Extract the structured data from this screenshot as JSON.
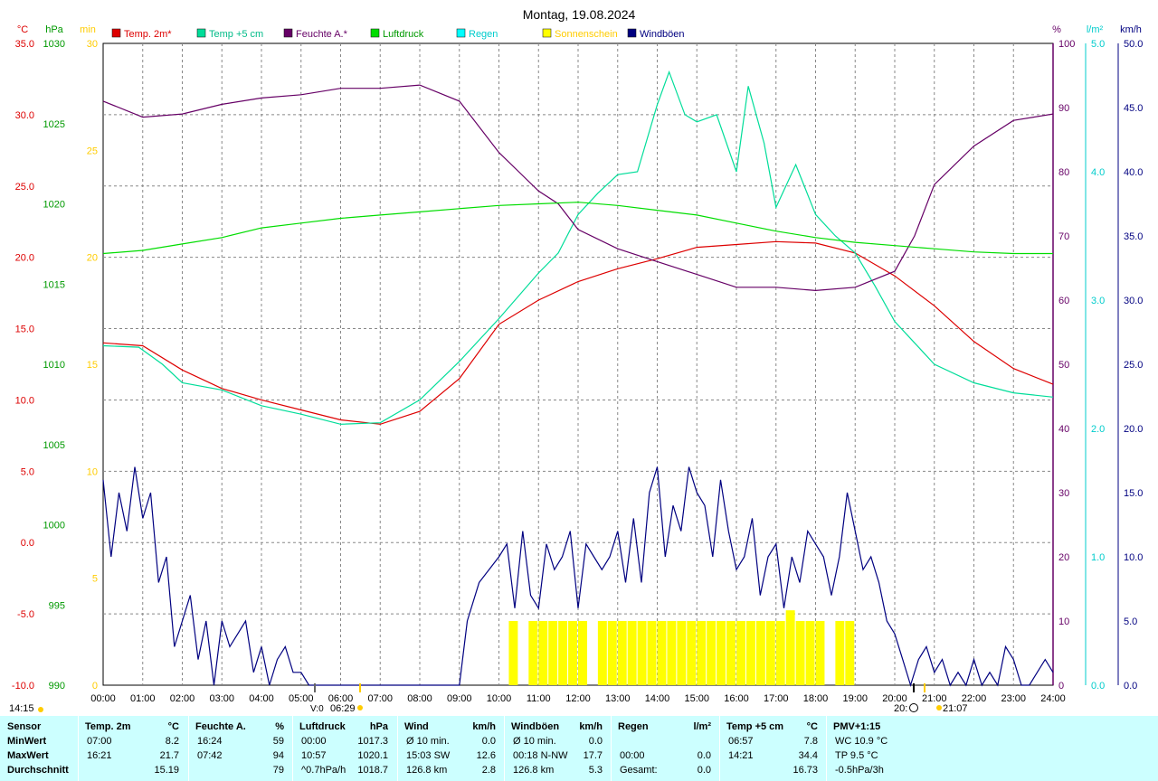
{
  "title": "Montag, 19.08.2024",
  "legend": [
    {
      "label": "Temp. 2m*",
      "color": "#dd0000",
      "text_color": "#dd0000"
    },
    {
      "label": "Temp +5 cm",
      "color": "#00dd99",
      "text_color": "#00bb88"
    },
    {
      "label": "Feuchte A.*",
      "color": "#660066",
      "text_color": "#660066"
    },
    {
      "label": "Luftdruck",
      "color": "#00dd00",
      "text_color": "#009900"
    },
    {
      "label": "Regen",
      "color": "#00ffff",
      "text_color": "#00cccc"
    },
    {
      "label": "Sonnenschein",
      "color": "#ffff00",
      "text_color": "#ffcc00"
    },
    {
      "label": "Windböen",
      "color": "#000080",
      "text_color": "#000080"
    }
  ],
  "axes": {
    "temp": {
      "unit": "°C",
      "ticks": [
        "35.0",
        "30.0",
        "25.0",
        "20.0",
        "15.0",
        "10.0",
        "5.0",
        "0.0",
        "-5.0",
        "-10.0"
      ],
      "color": "#dd0000"
    },
    "pressure": {
      "unit": "hPa",
      "ticks": [
        "1030",
        "1025",
        "1020",
        "1015",
        "1010",
        "1005",
        "1000",
        "995",
        "990"
      ],
      "color": "#009900"
    },
    "sun": {
      "unit": "min",
      "ticks": [
        "30",
        "25",
        "20",
        "15",
        "10",
        "5",
        "0"
      ],
      "color": "#ffcc00"
    },
    "humidity": {
      "unit": "%",
      "ticks": [
        "100",
        "90",
        "80",
        "70",
        "60",
        "50",
        "40",
        "30",
        "20",
        "10",
        "0"
      ],
      "color": "#660066"
    },
    "rain": {
      "unit": "l/m²",
      "ticks": [
        "5.0",
        "4.0",
        "3.0",
        "2.0",
        "1.0",
        "0.0"
      ],
      "color": "#00cccc"
    },
    "wind": {
      "unit": "km/h",
      "ticks": [
        "50.0",
        "45.0",
        "40.0",
        "35.0",
        "30.0",
        "25.0",
        "20.0",
        "15.0",
        "10.0",
        "5.0",
        "0.0"
      ],
      "color": "#000080"
    },
    "time_ticks": [
      "00:00",
      "01:00",
      "02:00",
      "03:00",
      "04:00",
      "05:00",
      "06:00",
      "07:00",
      "08:00",
      "09:00",
      "10:00",
      "11:00",
      "12:00",
      "13:00",
      "14:00",
      "15:00",
      "16:00",
      "17:00",
      "18:00",
      "19:00",
      "20:00",
      "21:00",
      "22:00",
      "23:00",
      "24:00"
    ]
  },
  "markers": {
    "left_time": "14:15",
    "sunrise": "06:29",
    "sunset_moon": "20:",
    "sunset": "21:07",
    "small_marker": "V:0"
  },
  "chart_data": {
    "type": "line",
    "x_unit": "hours",
    "xlim": [
      0,
      24
    ],
    "series": [
      {
        "name": "Temp. 2m*",
        "axis": "temp",
        "color": "#dd0000",
        "x": [
          0,
          1,
          2,
          3,
          4,
          5,
          6,
          7,
          8,
          9,
          10,
          11,
          12,
          13,
          14,
          15,
          16,
          17,
          18,
          19,
          20,
          21,
          22,
          23,
          24
        ],
        "y": [
          14.0,
          13.8,
          12.1,
          10.8,
          10.0,
          9.3,
          8.6,
          8.3,
          9.2,
          11.5,
          15.3,
          17.0,
          18.3,
          19.2,
          19.9,
          20.7,
          20.9,
          21.1,
          21.0,
          20.3,
          18.7,
          16.6,
          14.1,
          12.2,
          11.1
        ]
      },
      {
        "name": "Temp +5 cm",
        "axis": "temp",
        "color": "#00dd99",
        "x": [
          0,
          0.9,
          1.5,
          2.0,
          3.0,
          4.0,
          5.0,
          6.0,
          7.0,
          8.0,
          9.0,
          10.0,
          11.0,
          11.5,
          12.0,
          12.5,
          13.0,
          13.5,
          14.0,
          14.3,
          14.7,
          15.0,
          15.5,
          16.0,
          16.3,
          16.7,
          17.0,
          17.5,
          18.0,
          18.5,
          19.0,
          19.5,
          20.0,
          20.5,
          21.0,
          22.0,
          23.0,
          24.0
        ],
        "y": [
          13.8,
          13.7,
          12.5,
          11.2,
          10.7,
          9.6,
          9.0,
          8.3,
          8.4,
          10.0,
          12.7,
          15.7,
          18.9,
          20.3,
          23.0,
          24.5,
          25.8,
          26.0,
          30.7,
          33.0,
          30.0,
          29.5,
          30.0,
          26.0,
          32.0,
          28.0,
          23.5,
          26.5,
          23.0,
          21.5,
          20.3,
          18.0,
          15.5,
          14.0,
          12.5,
          11.2,
          10.5,
          10.2
        ]
      },
      {
        "name": "Feuchte A.*",
        "axis": "humidity",
        "color": "#660066",
        "x": [
          0,
          1,
          2,
          3,
          4,
          5,
          6,
          7,
          8,
          9,
          10,
          10.5,
          11,
          11.5,
          12,
          13,
          14,
          15,
          16,
          17,
          18,
          19,
          20,
          20.5,
          21,
          22,
          23,
          24
        ],
        "y": [
          91,
          88.5,
          89,
          90.5,
          91.5,
          92,
          93,
          93,
          93.5,
          91,
          83,
          80,
          77,
          75,
          71,
          68,
          66,
          64,
          62,
          62,
          61.5,
          62,
          64.5,
          70,
          78,
          84,
          88,
          89
        ]
      },
      {
        "name": "Luftdruck",
        "axis": "pressure",
        "color": "#00dd00",
        "x": [
          0,
          1,
          2,
          3,
          4,
          5,
          6,
          7,
          8,
          9,
          10,
          11,
          12,
          13,
          14,
          15,
          16,
          17,
          18,
          19,
          20,
          21,
          22,
          23,
          24
        ],
        "y": [
          1016.9,
          1017.1,
          1017.5,
          1017.9,
          1018.5,
          1018.8,
          1019.1,
          1019.3,
          1019.5,
          1019.7,
          1019.9,
          1020.0,
          1020.1,
          1019.9,
          1019.6,
          1019.3,
          1018.8,
          1018.3,
          1017.9,
          1017.6,
          1017.4,
          1017.2,
          1017.0,
          1016.9,
          1016.9
        ]
      },
      {
        "name": "Windböen",
        "axis": "wind",
        "color": "#000080",
        "x": [
          0,
          0.2,
          0.4,
          0.6,
          0.8,
          1.0,
          1.2,
          1.4,
          1.6,
          1.8,
          2.0,
          2.2,
          2.4,
          2.6,
          2.8,
          3.0,
          3.2,
          3.4,
          3.6,
          3.8,
          4.0,
          4.2,
          4.4,
          4.6,
          4.8,
          5.0,
          5.2,
          5.4,
          5.6,
          5.8,
          6.0,
          6.5,
          7.0,
          7.5,
          8.0,
          8.5,
          9.0,
          9.2,
          9.5,
          10.0,
          10.2,
          10.4,
          10.6,
          10.8,
          11.0,
          11.2,
          11.4,
          11.6,
          11.8,
          12.0,
          12.2,
          12.4,
          12.6,
          12.8,
          13.0,
          13.2,
          13.4,
          13.6,
          13.8,
          14.0,
          14.2,
          14.4,
          14.6,
          14.8,
          15.0,
          15.2,
          15.4,
          15.6,
          15.8,
          16.0,
          16.2,
          16.4,
          16.6,
          16.8,
          17.0,
          17.2,
          17.4,
          17.6,
          17.8,
          18.0,
          18.2,
          18.4,
          18.6,
          18.8,
          19.0,
          19.2,
          19.4,
          19.6,
          19.8,
          20.0,
          20.2,
          20.4,
          20.6,
          20.8,
          21.0,
          21.2,
          21.4,
          21.6,
          21.8,
          22.0,
          22.2,
          22.4,
          22.6,
          22.8,
          23.0,
          23.2,
          23.4,
          23.6,
          23.8,
          24.0
        ],
        "y": [
          16,
          10,
          15,
          12,
          17,
          13,
          15,
          8,
          10,
          3,
          5,
          7,
          2,
          5,
          0,
          5,
          3,
          4,
          5,
          1,
          3,
          0,
          2,
          3,
          1,
          1,
          0,
          0,
          0,
          0,
          0,
          0,
          0,
          0,
          0,
          0,
          0,
          5,
          8,
          10,
          11,
          6,
          12,
          7,
          6,
          11,
          9,
          10,
          12,
          6,
          11,
          10,
          9,
          10,
          12,
          8,
          13,
          8,
          15,
          17,
          10,
          14,
          12,
          17,
          15,
          14,
          10,
          16,
          12,
          9,
          10,
          13,
          7,
          10,
          11,
          6,
          10,
          8,
          12,
          11,
          10,
          7,
          10,
          15,
          12,
          9,
          10,
          8,
          5,
          4,
          2,
          0,
          2,
          3,
          1,
          2,
          0,
          1,
          0,
          2,
          0,
          1,
          0,
          3,
          2,
          0,
          0,
          1,
          2,
          1
        ]
      },
      {
        "name": "Sonnenschein",
        "axis": "sun",
        "type": "bar",
        "color": "#ffff00",
        "x": [
          10.25,
          10.5,
          10.75,
          11.0,
          11.25,
          11.5,
          11.75,
          12.0,
          12.25,
          12.5,
          12.75,
          13.0,
          13.25,
          13.5,
          13.75,
          14.0,
          14.25,
          14.5,
          14.75,
          15.0,
          15.25,
          15.5,
          15.75,
          16.0,
          16.25,
          16.5,
          16.75,
          17.0,
          17.25,
          17.5,
          17.75,
          18.0,
          18.25,
          18.5,
          18.75
        ],
        "y": [
          3,
          0,
          3,
          3,
          3,
          3,
          3,
          3,
          0,
          3,
          3,
          3,
          3,
          3,
          3,
          3,
          3,
          3,
          3,
          3,
          3,
          3,
          3,
          3,
          3,
          3,
          3,
          3,
          3.5,
          3,
          3,
          3,
          0,
          3,
          3
        ]
      }
    ]
  },
  "stats": {
    "row_labels": [
      "Sensor",
      "MinWert",
      "MaxWert",
      "Durchschnitt"
    ],
    "columns": [
      {
        "head": "Temp. 2m",
        "unit": "°C",
        "rows": [
          [
            "07:00",
            "8.2"
          ],
          [
            "16:21",
            "21.7"
          ],
          [
            "",
            "15.19"
          ]
        ]
      },
      {
        "head": "Feuchte A.",
        "unit": "%",
        "rows": [
          [
            "16:24",
            "59"
          ],
          [
            "07:42",
            "94"
          ],
          [
            "",
            "79"
          ]
        ]
      },
      {
        "head": "Luftdruck",
        "unit": "hPa",
        "rows": [
          [
            "00:00",
            "1017.3"
          ],
          [
            "10:57",
            "1020.1"
          ],
          [
            "^0.7hPa/h",
            "1018.7"
          ]
        ]
      },
      {
        "head": "Wind",
        "unit": "km/h",
        "rows": [
          [
            "Ø 10 min.",
            "0.0"
          ],
          [
            "15:03  SW",
            "12.6"
          ],
          [
            "126.8 km",
            "2.8"
          ]
        ]
      },
      {
        "head": "Windböen",
        "unit": "km/h",
        "rows": [
          [
            "Ø 10 min.",
            "0.0"
          ],
          [
            "00:18  N-NW",
            "17.7"
          ],
          [
            "126.8 km",
            "5.3"
          ]
        ]
      },
      {
        "head": "Regen",
        "unit": "l/m²",
        "rows": [
          [
            "",
            ""
          ],
          [
            "00:00",
            "0.0"
          ],
          [
            "Gesamt:",
            "0.0"
          ]
        ]
      },
      {
        "head": "Temp +5 cm",
        "unit": "°C",
        "rows": [
          [
            "06:57",
            "7.8"
          ],
          [
            "14:21",
            "34.4"
          ],
          [
            "",
            "16.73"
          ]
        ]
      },
      {
        "head": "PMV+1:15",
        "unit": "",
        "rows": [
          [
            "WC 10.9 °C",
            ""
          ],
          [
            "TP 9.5 °C",
            ""
          ],
          [
            "-0.5hPa/3h",
            ""
          ]
        ]
      }
    ]
  }
}
